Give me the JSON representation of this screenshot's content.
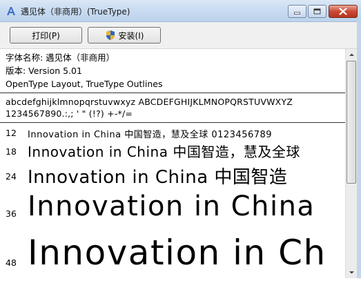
{
  "window": {
    "title": "遇见体（非商用）(TrueType)",
    "icon": "font-file-icon"
  },
  "toolbar": {
    "print_label": "打印(P)",
    "install_label": "安装(I)"
  },
  "info": {
    "font_name": "字体名称: 遇见体（非商用）",
    "version": "版本: Version 5.01",
    "outline": "OpenType Layout, TrueType Outlines"
  },
  "charset": {
    "line1": "abcdefghijklmnopqrstuvwxyz ABCDEFGHIJKLMNOPQRSTUVWXYZ",
    "line2": "1234567890.:,; ' \" (!?) +-*/="
  },
  "samples": [
    {
      "size": "12",
      "text": "Innovation in China 中国智造，慧及全球 0123456789"
    },
    {
      "size": "18",
      "text": "Innovation in China 中国智造，慧及全球"
    },
    {
      "size": "24",
      "text": "Innovation in China 中国智造"
    },
    {
      "size": "36",
      "text": "Innovation in China"
    },
    {
      "size": "48",
      "text": "Innovation in Ch"
    }
  ]
}
